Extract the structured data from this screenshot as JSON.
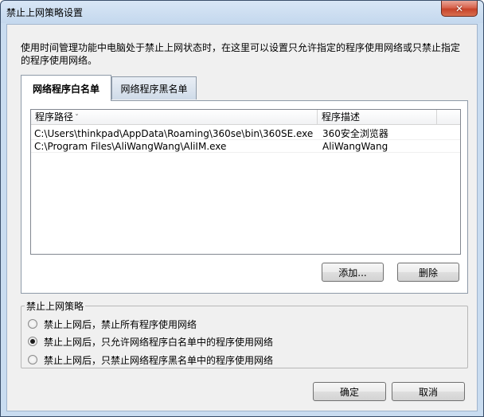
{
  "window": {
    "title": "禁止上网策略设置",
    "close_label": "✕"
  },
  "description": "使用时间管理功能中电脑处于禁止上网状态时，在这里可以设置只允许指定的程序使用网络或只禁止指定的程序使用网络。",
  "tabs": [
    {
      "label": "网络程序白名单",
      "active": true
    },
    {
      "label": "网络程序黑名单",
      "active": false
    }
  ],
  "list": {
    "columns": [
      "程序路径",
      "程序描述"
    ],
    "rows": [
      {
        "path": "C:\\Users\\thinkpad\\AppData\\Roaming\\360se\\bin\\360SE.exe",
        "desc": "360安全浏览器"
      },
      {
        "path": "C:\\Program Files\\AliWangWang\\AliIM.exe",
        "desc": "AliWangWang"
      }
    ]
  },
  "buttons": {
    "add": "添加...",
    "delete": "删除",
    "ok": "确定",
    "cancel": "取消"
  },
  "policy": {
    "title": "禁止上网策略",
    "options": [
      {
        "label": "禁止上网后，禁止所有程序使用网络",
        "checked": false
      },
      {
        "label": "禁止上网后，只允许网络程序白名单中的程序使用网络",
        "checked": true
      },
      {
        "label": "禁止上网后，只禁止网络程序黑名单中的程序使用网络",
        "checked": false
      }
    ]
  }
}
